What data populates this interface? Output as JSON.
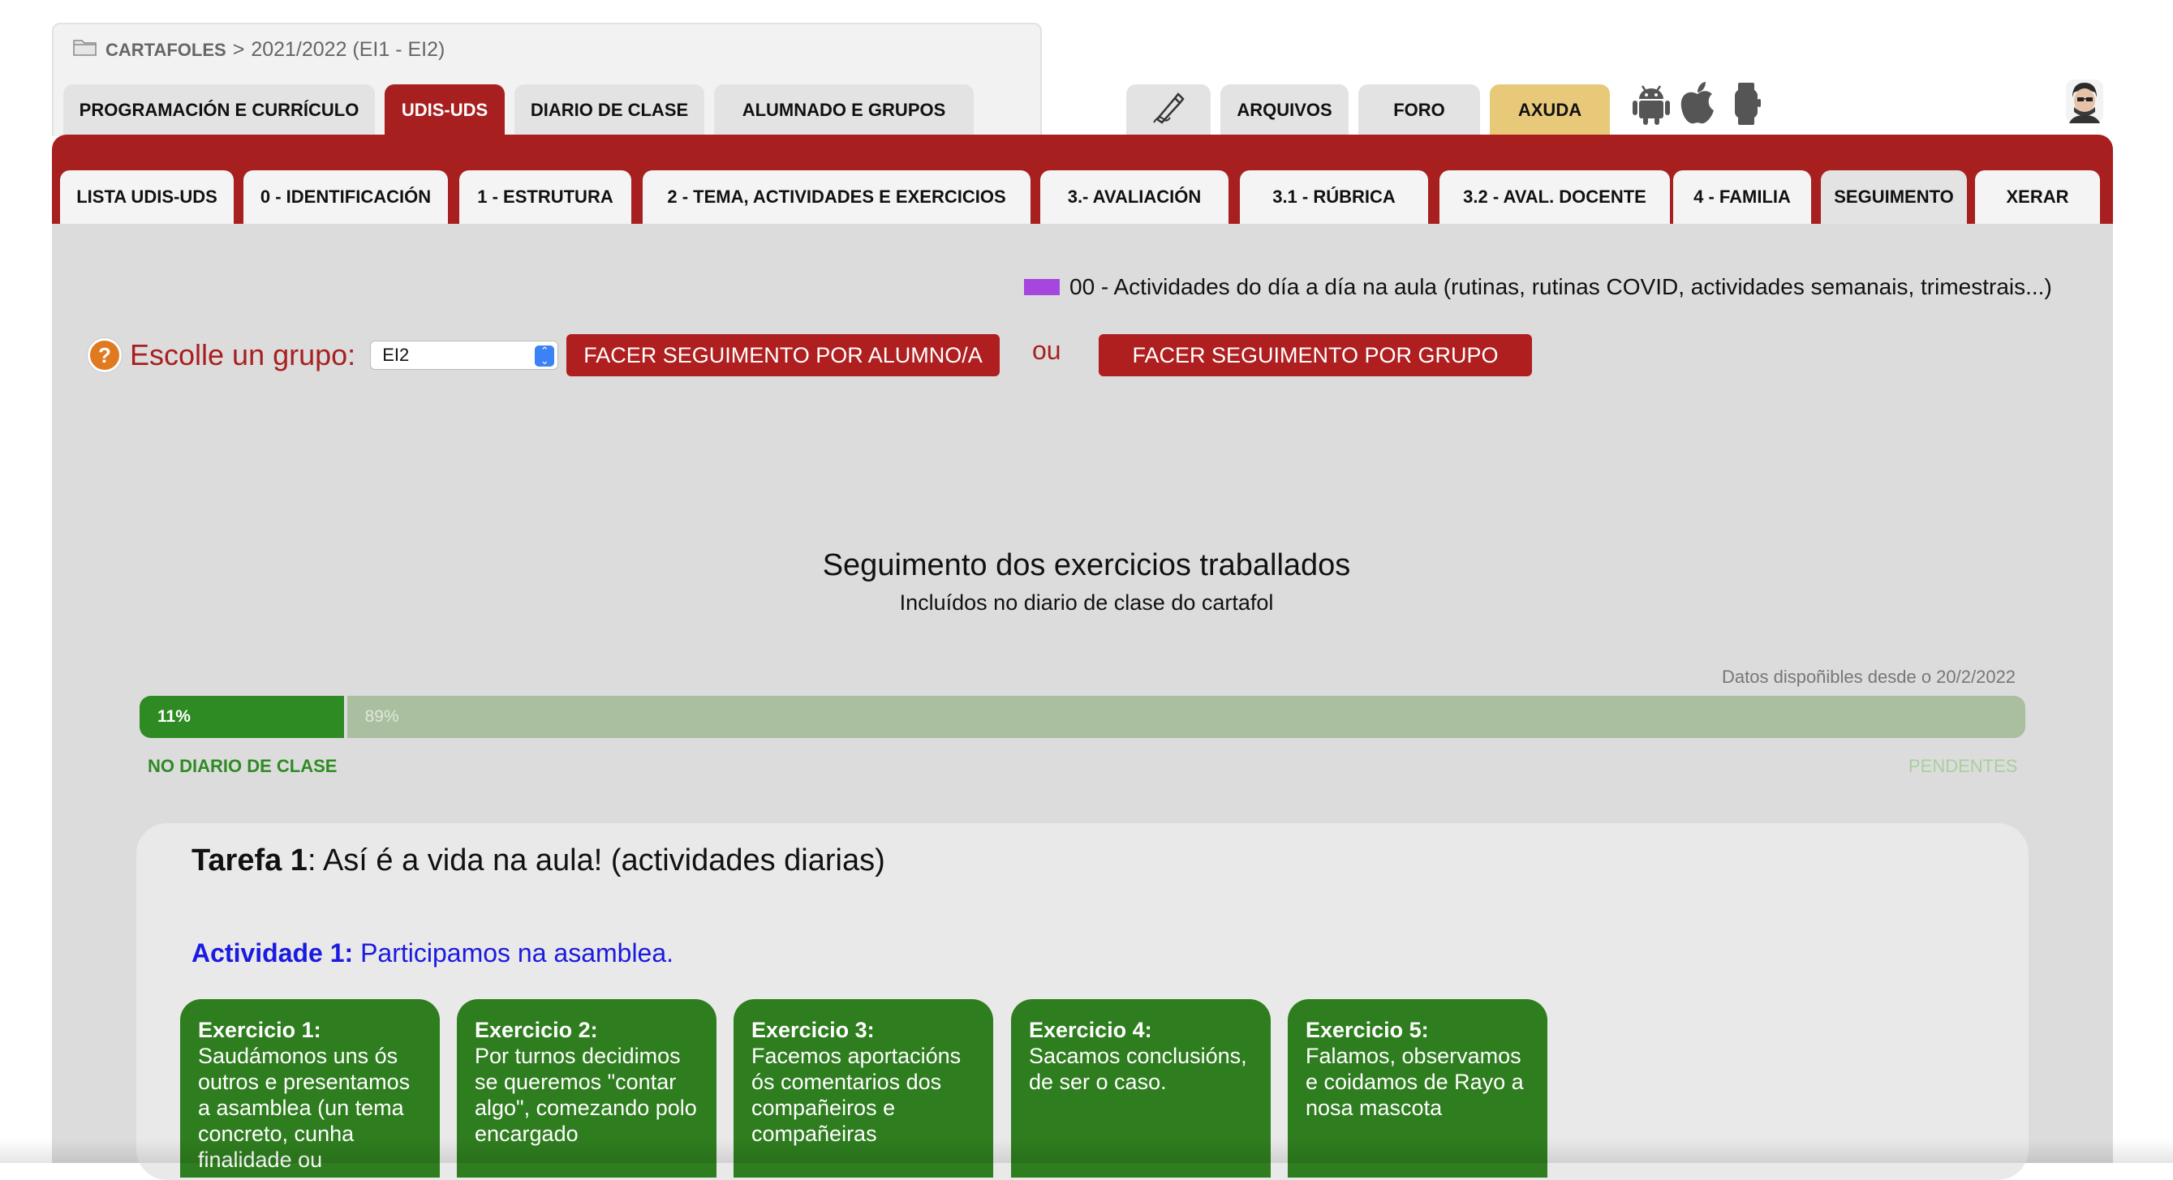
{
  "breadcrumb": {
    "root": "CARTAFOLES",
    "separator": ">",
    "current": "2021/2022 (EI1 - EI2)"
  },
  "top_tabs": [
    {
      "label": "PROGRAMACIÓN E CURRÍCULO"
    },
    {
      "label": "UDIS-UDS",
      "active": true
    },
    {
      "label": "DIARIO DE CLASE"
    },
    {
      "label": "ALUMNADO E GRUPOS"
    }
  ],
  "right_tabs": [
    {
      "icon": "pen-icon"
    },
    {
      "label": "ARQUIVOS"
    },
    {
      "label": "FORO"
    },
    {
      "label": "AXUDA",
      "color": "#e8c97a"
    }
  ],
  "platform_icons": [
    "android-icon",
    "apple-icon",
    "watch-icon"
  ],
  "sub_tabs": [
    {
      "label": "LISTA UDIS-UDS"
    },
    {
      "label": "0 - IDENTIFICACIÓN"
    },
    {
      "label": "1 - ESTRUTURA"
    },
    {
      "label": "2 - TEMA, ACTIVIDADES E EXERCICIOS"
    },
    {
      "label": "3.- AVALIACIÓN"
    },
    {
      "label": "3.1 - RÚBRICA"
    },
    {
      "label": "3.2 - AVAL. DOCENTE"
    },
    {
      "label": "4 - FAMILIA"
    },
    {
      "label": "SEGUIMENTO",
      "active": true
    },
    {
      "label": "XERAR"
    }
  ],
  "legend": {
    "color": "#a646df",
    "label": "00 - Actividades do día a día na aula (rutinas, rutinas COVID, actividades semanais, trimestrais...)"
  },
  "group_selector": {
    "help_icon": "?",
    "label": "Escolle un grupo:",
    "value": "EI2"
  },
  "buttons": {
    "by_student": "FACER SEGUIMENTO POR ALUMNO/A",
    "or": "ou",
    "by_group": "FACER SEGUIMENTO POR GRUPO"
  },
  "follow_up": {
    "title": "Seguimento dos exercicios traballados",
    "subtitle": "Incluídos no diario de clase do cartafol",
    "data_since": "Datos dispoñibles desde o 20/2/2022",
    "done_percent": 11,
    "done_label": "11%",
    "pending_label": "89%",
    "done_caption": "NO DIARIO DE CLASE",
    "pending_caption": "PENDENTES"
  },
  "colors": {
    "brand_red": "#a81f1f",
    "progress_done": "#2e8b23",
    "progress_pending": "#a9bf9f",
    "exercise_green": "#2e7d1e"
  },
  "task": {
    "title_bold": "Tarefa 1",
    "title_rest": ": Así é a vida na aula!  (actividades diarias)",
    "activity_bold": "Actividade 1:",
    "activity_rest": " Participamos na asamblea.",
    "exercises": [
      {
        "title": "Exercicio 1:",
        "text": "Saudámonos uns ós outros e presentamos a asamblea (un tema concreto, cunha finalidade ou"
      },
      {
        "title": "Exercicio 2:",
        "text": "Por turnos decidimos se queremos \"contar algo\", comezando polo encargado"
      },
      {
        "title": "Exercicio 3:",
        "text": "Facemos aportacións ós comentarios dos compañeiros e compañeiras"
      },
      {
        "title": "Exercicio 4:",
        "text": "Sacamos conclusións, de ser o caso."
      },
      {
        "title": "Exercicio 5:",
        "text": "Falamos, observamos e coidamos de Rayo a nosa mascota"
      }
    ]
  }
}
